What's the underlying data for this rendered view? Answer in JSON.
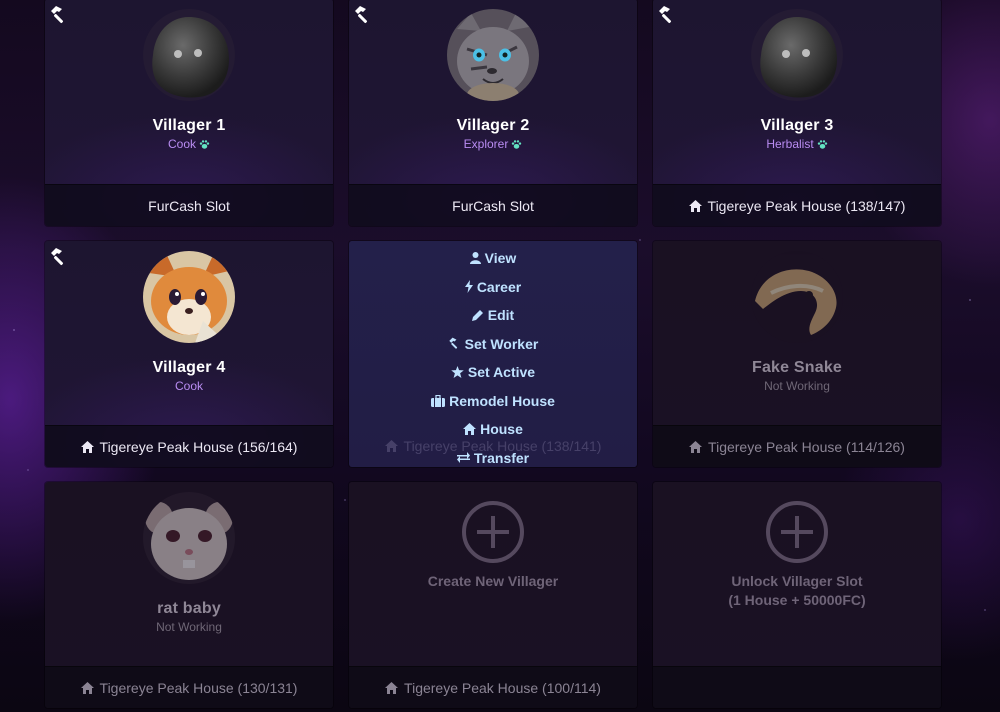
{
  "cards": [
    {
      "name": "Villager 1",
      "career": "Cook",
      "footer": "FurCash Slot"
    },
    {
      "name": "Villager 2",
      "career": "Explorer",
      "footer": "FurCash Slot"
    },
    {
      "name": "Villager 3",
      "career": "Herbalist",
      "footer": "Tigereye Peak House (138/147)"
    },
    {
      "name": "Villager 4",
      "career": "Cook",
      "footer": "Tigereye Peak House (156/164)"
    },
    {
      "footer": "Tigereye Peak House (138/141)"
    },
    {
      "name": "Fake Snake",
      "career": "Not Working",
      "footer": "Tigereye Peak House (114/126)"
    },
    {
      "name": "rat baby",
      "career": "Not Working",
      "footer": "Tigereye Peak House (130/131)"
    },
    {
      "label": "Create New Villager",
      "footer": "Tigereye Peak House (100/114)"
    },
    {
      "label_line1": "Unlock Villager Slot",
      "label_line2": "(1 House + 50000FC)"
    }
  ],
  "menu": {
    "view": "View",
    "career": "Career",
    "edit": "Edit",
    "set_worker": "Set Worker",
    "set_active": "Set Active",
    "remodel_house": "Remodel House",
    "house": "House",
    "transfer": "Transfer"
  },
  "colors": {
    "career_text": "#b98cf2",
    "menu_text": "#bfe2ff",
    "paw_icon": "#63e3c2"
  }
}
